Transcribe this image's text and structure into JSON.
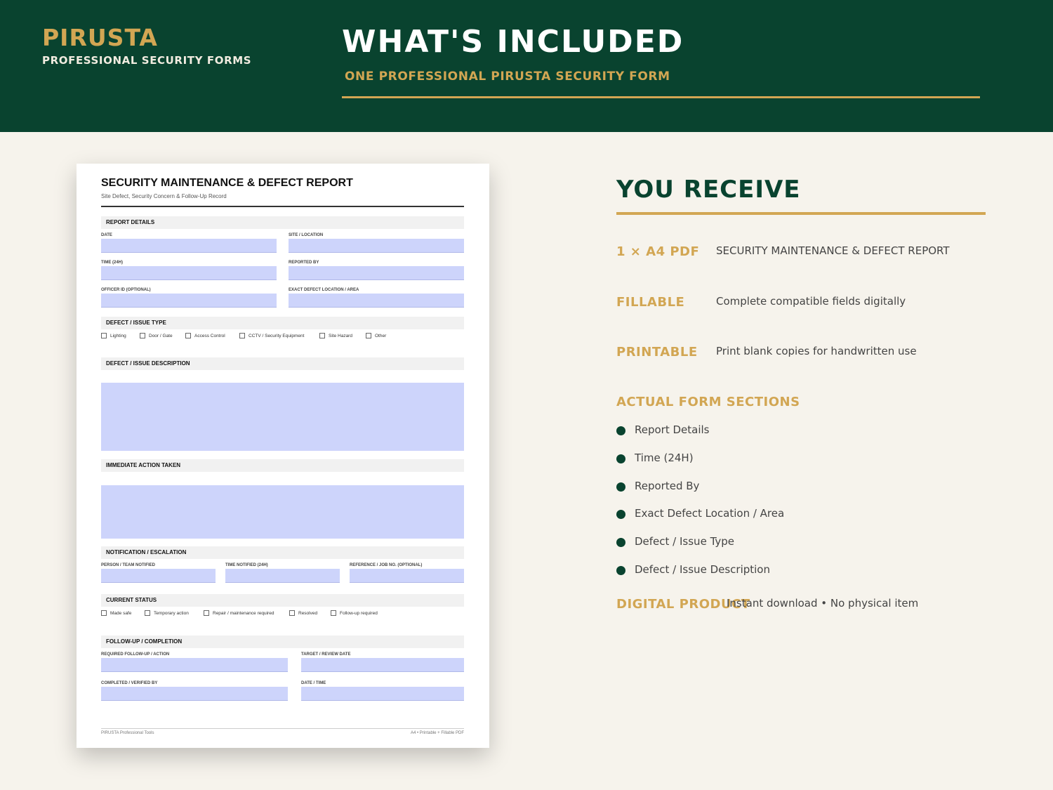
{
  "header": {
    "brand": "PIRUSTA",
    "brand_sub": "PROFESSIONAL SECURITY FORMS",
    "title": "WHAT'S INCLUDED",
    "subtitle": "ONE PROFESSIONAL PIRUSTA SECURITY FORM"
  },
  "form": {
    "title": "SECURITY MAINTENANCE & DEFECT REPORT",
    "subtitle": "Site Defect, Security Concern & Follow-Up Record",
    "sections": {
      "report_details": "REPORT DETAILS",
      "defect_type": "DEFECT / ISSUE TYPE",
      "defect_description": "DEFECT / ISSUE DESCRIPTION",
      "immediate_action": "IMMEDIATE ACTION TAKEN",
      "notification": "NOTIFICATION / ESCALATION",
      "current_status": "CURRENT STATUS",
      "follow_up": "FOLLOW-UP / COMPLETION"
    },
    "labels": {
      "date": "DATE",
      "site_location": "SITE / LOCATION",
      "time_24h": "TIME (24H)",
      "reported_by": "REPORTED BY",
      "officer_id": "OFFICER ID (OPTIONAL)",
      "exact_location": "EXACT DEFECT LOCATION / AREA",
      "person_notified": "PERSON / TEAM NOTIFIED",
      "time_notified": "TIME NOTIFIED (24H)",
      "reference": "REFERENCE / JOB NO. (OPTIONAL)",
      "required_follow_up": "REQUIRED FOLLOW-UP / ACTION",
      "target_date": "TARGET / REVIEW DATE",
      "completed_by": "COMPLETED / VERIFIED BY",
      "date_time": "DATE / TIME"
    },
    "defect_types": [
      "Lighting",
      "Door / Gate",
      "Access Control",
      "CCTV / Security Equipment",
      "Site Hazard",
      "Other"
    ],
    "statuses": [
      "Made safe",
      "Temporary action",
      "Repair / maintenance required",
      "Resolved",
      "Follow-up required"
    ],
    "footer_left": "PIRUSTA Professional Tools",
    "footer_right": "A4 • Printable + Fillable PDF"
  },
  "panel": {
    "title": "YOU RECEIVE",
    "features": [
      {
        "key": "1 × A4 PDF",
        "value": "SECURITY MAINTENANCE & DEFECT REPORT"
      },
      {
        "key": "FILLABLE",
        "value": "Complete compatible fields digitally"
      },
      {
        "key": "PRINTABLE",
        "value": "Print blank copies for handwritten use"
      }
    ],
    "sections_heading": "ACTUAL FORM SECTIONS",
    "sections": [
      "Report Details",
      "Time (24H)",
      "Reported By",
      "Exact Defect Location / Area",
      "Defect / Issue Type",
      "Defect / Issue Description"
    ],
    "digital_key": "DIGITAL PRODUCT",
    "digital_value": "Instant download • No physical item"
  },
  "colors": {
    "green": "#09432f",
    "gold": "#d2a653",
    "field": "#cdd4fb",
    "background": "#f6f3ec"
  }
}
